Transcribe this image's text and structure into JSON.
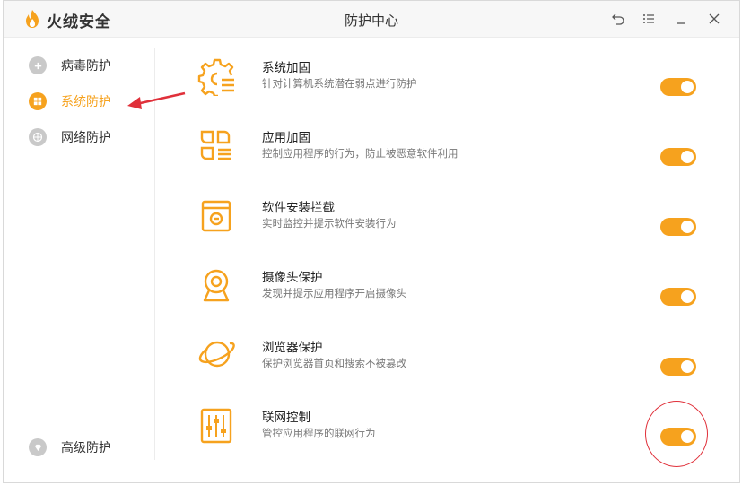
{
  "app": {
    "brand": "火绒安全",
    "window_title": "防护中心"
  },
  "colors": {
    "accent": "#f6a21e",
    "icon_gray": "#c9c9c9",
    "annotation_red": "#e0303a"
  },
  "titlebar_buttons": [
    "back-icon",
    "menu-icon",
    "minimize-icon",
    "close-icon"
  ],
  "sidebar": {
    "items": [
      {
        "label": "病毒防护",
        "icon": "plus-shield-icon",
        "active": false
      },
      {
        "label": "系统防护",
        "icon": "windows-icon",
        "active": true
      },
      {
        "label": "网络防护",
        "icon": "globe-icon",
        "active": false
      }
    ],
    "bottom_item": {
      "label": "高级防护",
      "icon": "diamond-icon"
    }
  },
  "features": [
    {
      "title": "系统加固",
      "desc": "针对计算机系统潜在弱点进行防护",
      "icon": "gear-list-icon",
      "enabled": true
    },
    {
      "title": "应用加固",
      "desc": "控制应用程序的行为，防止被恶意软件利用",
      "icon": "apps-icon",
      "enabled": true
    },
    {
      "title": "软件安装拦截",
      "desc": "实时监控并提示软件安装行为",
      "icon": "install-box-icon",
      "enabled": true
    },
    {
      "title": "摄像头保护",
      "desc": "发现并提示应用程序开启摄像头",
      "icon": "webcam-icon",
      "enabled": true
    },
    {
      "title": "浏览器保护",
      "desc": "保护浏览器首页和搜索不被篡改",
      "icon": "planet-icon",
      "enabled": true
    },
    {
      "title": "联网控制",
      "desc": "管控应用程序的联网行为",
      "icon": "sliders-icon",
      "enabled": true
    }
  ]
}
